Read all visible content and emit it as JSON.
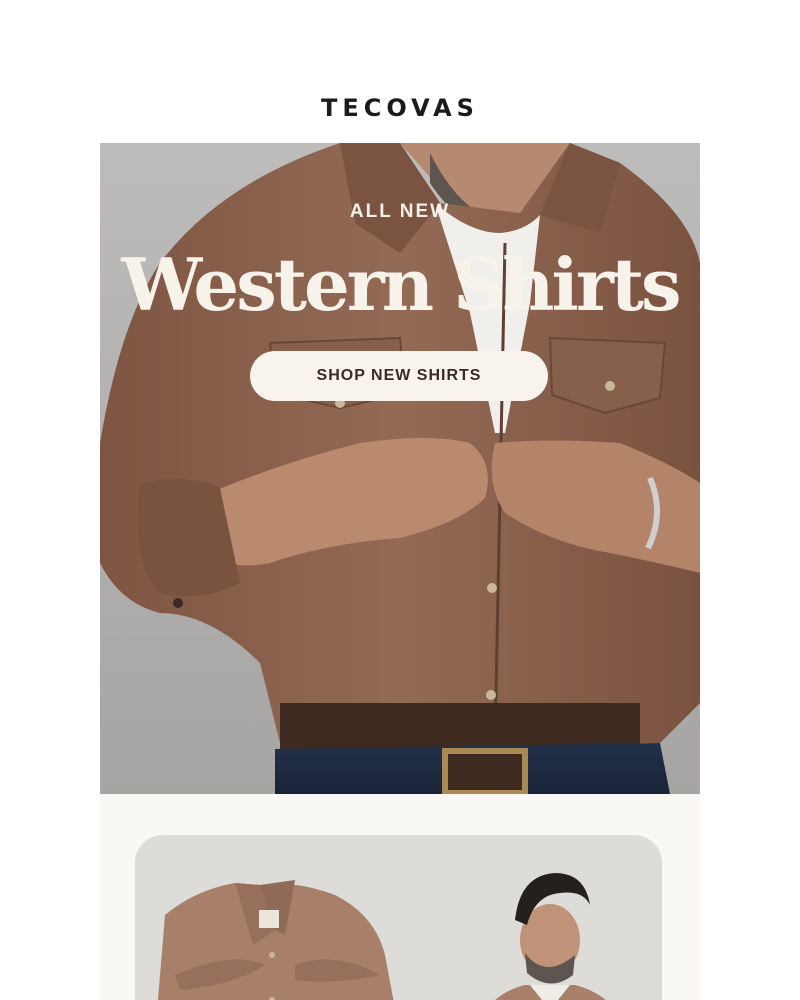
{
  "brand": {
    "logo_text": "TECOVAS"
  },
  "hero": {
    "eyebrow": "ALL NEW",
    "title": "Western Shirts",
    "cta_label": "SHOP NEW SHIRTS"
  },
  "colors": {
    "hero_background": "#b3b2b0",
    "shirt_brown": "#8a614c",
    "cta_background": "#f8f4ed",
    "cta_text": "#3b2a24",
    "section_cream": "#faf8f4"
  }
}
